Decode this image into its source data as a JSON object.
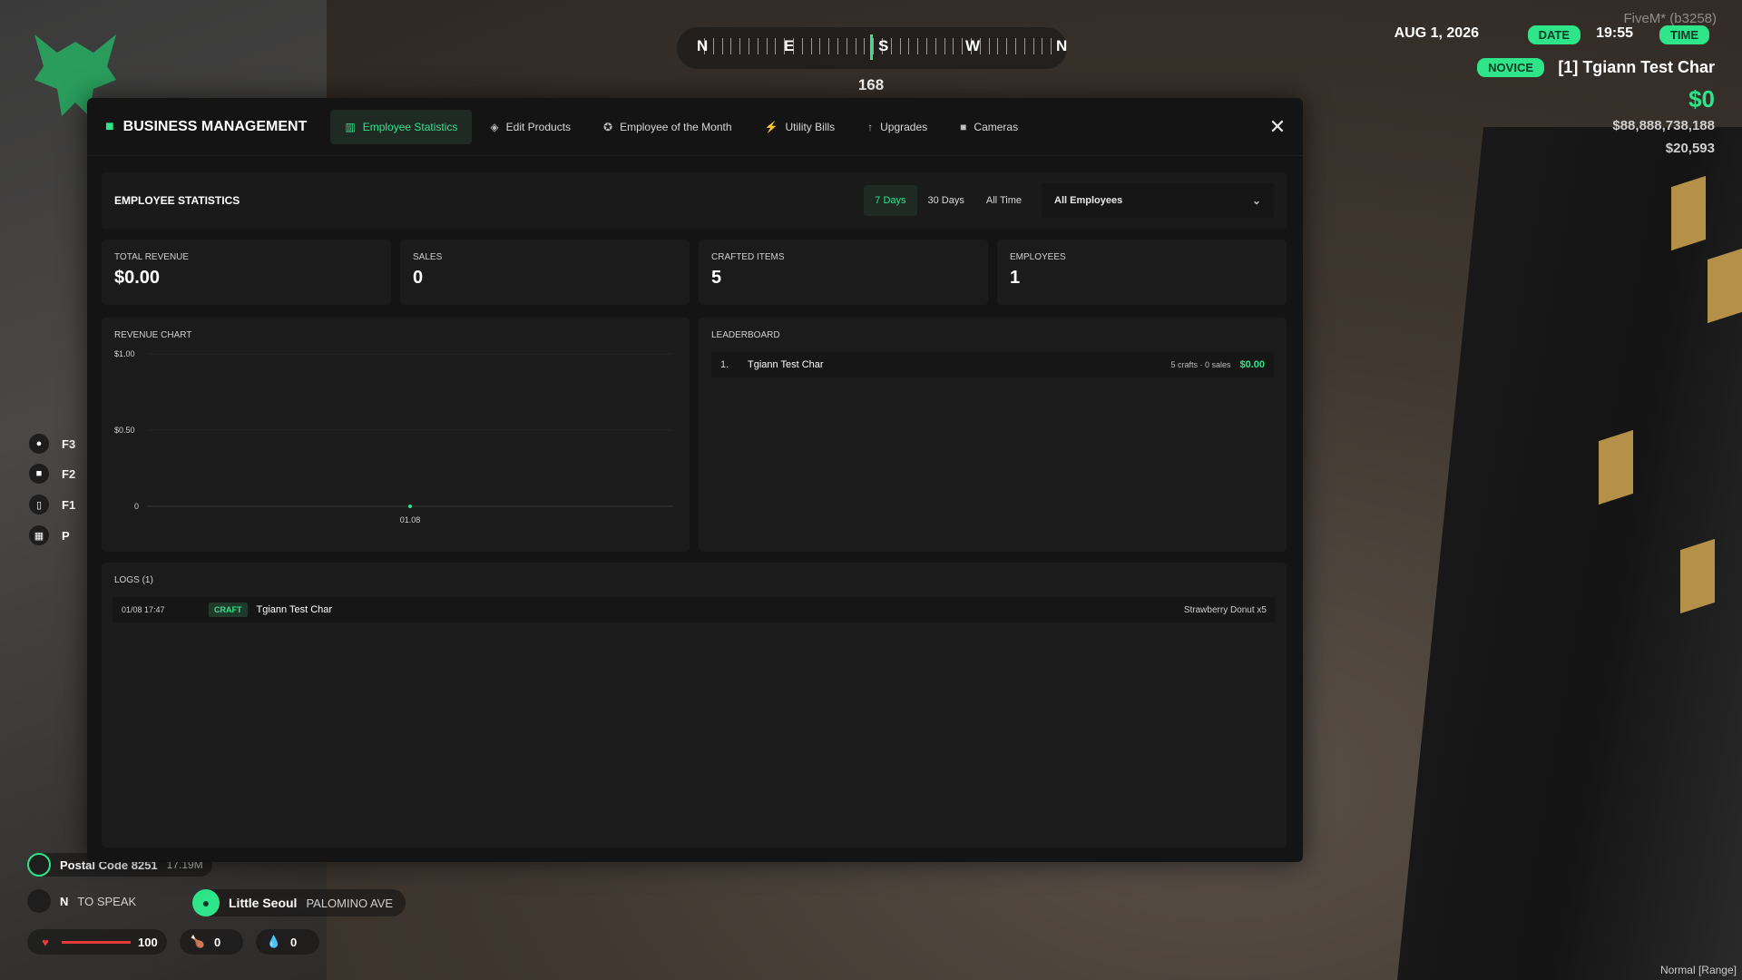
{
  "hud": {
    "compass": {
      "letters": [
        "N",
        "E",
        "S",
        "W",
        "N"
      ],
      "heading": "168"
    },
    "fivem": "FiveM* (b3258)",
    "date": "AUG 1, 2026",
    "date_label": "DATE",
    "time": "19:55",
    "time_label": "TIME",
    "rank": "NOVICE",
    "player": "[1] Tgiann Test Char",
    "cash": "$0",
    "bank": "$88,888,738,188",
    "other": "$20,593"
  },
  "keyhints": [
    {
      "icon": "settings-icon",
      "key": "F3"
    },
    {
      "icon": "inventory-icon",
      "key": "F2"
    },
    {
      "icon": "phone-icon",
      "key": "F1"
    },
    {
      "icon": "map-icon",
      "key": "P"
    }
  ],
  "bottom": {
    "postal": "Postal Code 8251",
    "distance": "17.19M",
    "speak_key": "N",
    "speak": "TO SPEAK",
    "area": "Little Seoul",
    "street": "PALOMINO AVE",
    "health": "100",
    "health_level": 1.0,
    "hunger": "0",
    "thirst": "0",
    "mode": "Normal [Range]"
  },
  "colors": {
    "accent": "#2ee58a",
    "panel": "#141414",
    "card": "#1b1b1b"
  },
  "panel": {
    "title": "BUSINESS MANAGEMENT",
    "tabs": [
      {
        "label": "Employee Statistics",
        "icon": "chart-icon",
        "active": true
      },
      {
        "label": "Edit Products",
        "icon": "tag-icon"
      },
      {
        "label": "Employee of the Month",
        "icon": "award-icon"
      },
      {
        "label": "Utility Bills",
        "icon": "bolt-icon"
      },
      {
        "label": "Upgrades",
        "icon": "arrow-up-icon"
      },
      {
        "label": "Cameras",
        "icon": "camera-icon"
      }
    ],
    "section_title": "EMPLOYEE STATISTICS",
    "ranges": [
      "7 Days",
      "30 Days",
      "All Time"
    ],
    "active_range": "7 Days",
    "employee_filter": "All Employees",
    "cards": [
      {
        "label": "TOTAL REVENUE",
        "value": "$0.00"
      },
      {
        "label": "SALES",
        "value": "0"
      },
      {
        "label": "CRAFTED ITEMS",
        "value": "5"
      },
      {
        "label": "EMPLOYEES",
        "value": "1"
      }
    ],
    "chart_title": "REVENUE CHART",
    "leaderboard_title": "LEADERBOARD",
    "leaderboard": [
      {
        "rank": "1.",
        "name": "Tgiann Test Char",
        "meta": "5 crafts · 0 sales",
        "amount": "$0.00"
      }
    ],
    "logs_title": "LOGS (1)",
    "logs": [
      {
        "time": "01/08 17:47",
        "type": "CRAFT",
        "name": "Tgiann Test Char",
        "detail": "Strawberry Donut x5"
      }
    ]
  },
  "chart_data": {
    "type": "line",
    "title": "REVENUE CHART",
    "x": [
      "01.08"
    ],
    "series": [
      {
        "values": [
          0
        ]
      }
    ],
    "ylim": [
      0,
      1
    ],
    "yticks": [
      "$1.00",
      "$0.50",
      "0"
    ],
    "grid": true
  }
}
